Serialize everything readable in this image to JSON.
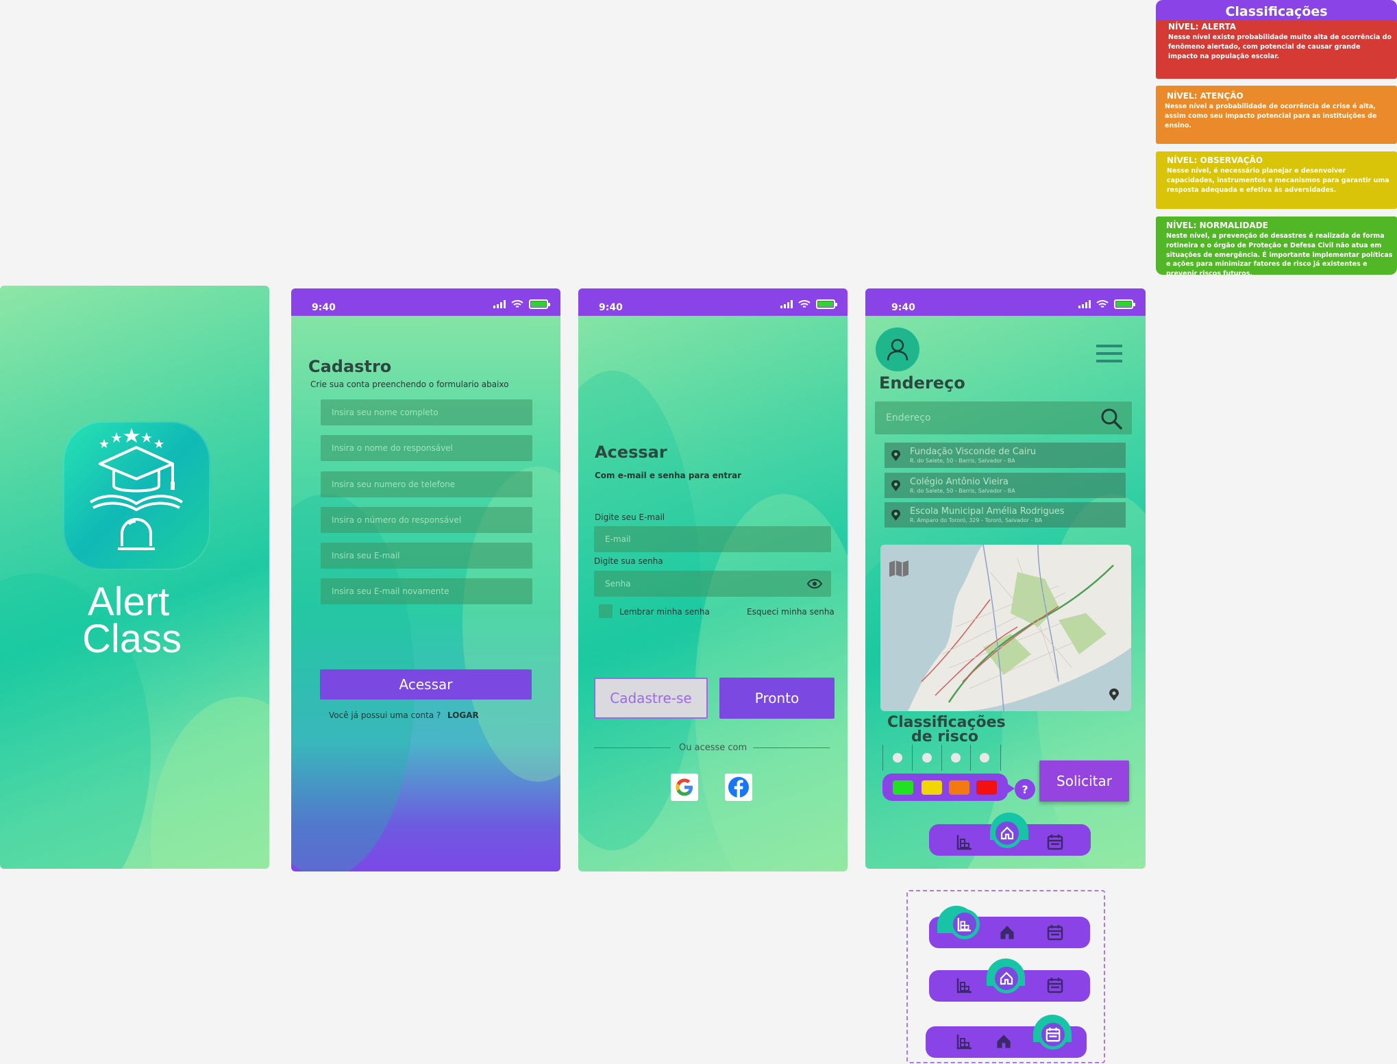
{
  "colors": {
    "purple": "#8a43e6",
    "accent": "#7b49e2",
    "alerta": "#d63a34",
    "atencao": "#ea8a2a",
    "observacao": "#d9c40a",
    "normalidade": "#52b727"
  },
  "classificacoes": {
    "title": "Classificações",
    "cards": [
      {
        "heading": "NÍVEL: ALERTA",
        "text": "Nesse nível existe probabilidade muito alta de ocorrência do fenômeno alertado, com potencial de causar grande impacto na população escolar."
      },
      {
        "heading": "NÍVEL: ATENÇÃO",
        "text": "Nesse nível a probabilidade de ocorrência de crise é alta, assim como seu impacto potencial para as instituições de ensino."
      },
      {
        "heading": "NÍVEL: OBSERVAÇÃO",
        "text": "Nesse nível, é necessário planejar e desenvolver capacidades, instrumentos e mecanismos para garantir uma resposta adequada e efetiva às adversidades."
      },
      {
        "heading": "NÍVEL: NORMALIDADE",
        "text": "Neste nível, a prevenção de desastres é realizada de forma rotineira e o órgão de Proteção e Defesa Civil não atua em situações de emergência. É importante implementar políticas e ações para minimizar fatores de risco já existentes e prevenir riscos futuros."
      }
    ]
  },
  "splash": {
    "line1": "Alert",
    "line2": "Class"
  },
  "statusbar": {
    "time": "9:40"
  },
  "cadastro": {
    "title": "Cadastro",
    "subtitle": "Crie sua conta preenchendo o formulario abaixo",
    "fields": [
      "Insira seu nome completo",
      "Insira o nome do responsável",
      "Insira seu numero de telefone",
      "Insira o número do responsável",
      "Insira seu E-mail",
      "Insira seu E-mail novamente"
    ],
    "button": "Acessar",
    "have_account": "Você já possui uma conta ?",
    "login_link": "LOGAR"
  },
  "acessar": {
    "title": "Acessar",
    "subtitle": "Com e-mail e senha para entrar",
    "email_label": "Digite seu E-mail",
    "email_placeholder": "E-mail",
    "password_label": "Digite sua senha",
    "password_placeholder": "Senha",
    "remember": "Lembrar minha senha",
    "forgot": "Esqueci minha senha",
    "signup_button": "Cadastre-se",
    "ready_button": "Pronto",
    "or_access": "Ou acesse com"
  },
  "endereco": {
    "title": "Endereço",
    "search_placeholder": "Endereço",
    "results": [
      {
        "name": "Fundação Visconde de Cairu",
        "address": "R. do Salete, 50 - Barris, Salvador - BA"
      },
      {
        "name": "Colégio Antônio Vieira",
        "address": "R. do Salete, 50 - Barris, Salvador - BA"
      },
      {
        "name": "Escola Municipal Amélia Rodrigues",
        "address": "R. Amparo do Tororó, 329 - Tororó, Salvador - BA"
      }
    ],
    "risk_title_1": "Classificações",
    "risk_title_2": "de risco",
    "risk_colors": [
      "#22e022",
      "#f2d600",
      "#f27a10",
      "#f21010"
    ],
    "help": "?",
    "request_button": "Solicitar"
  }
}
